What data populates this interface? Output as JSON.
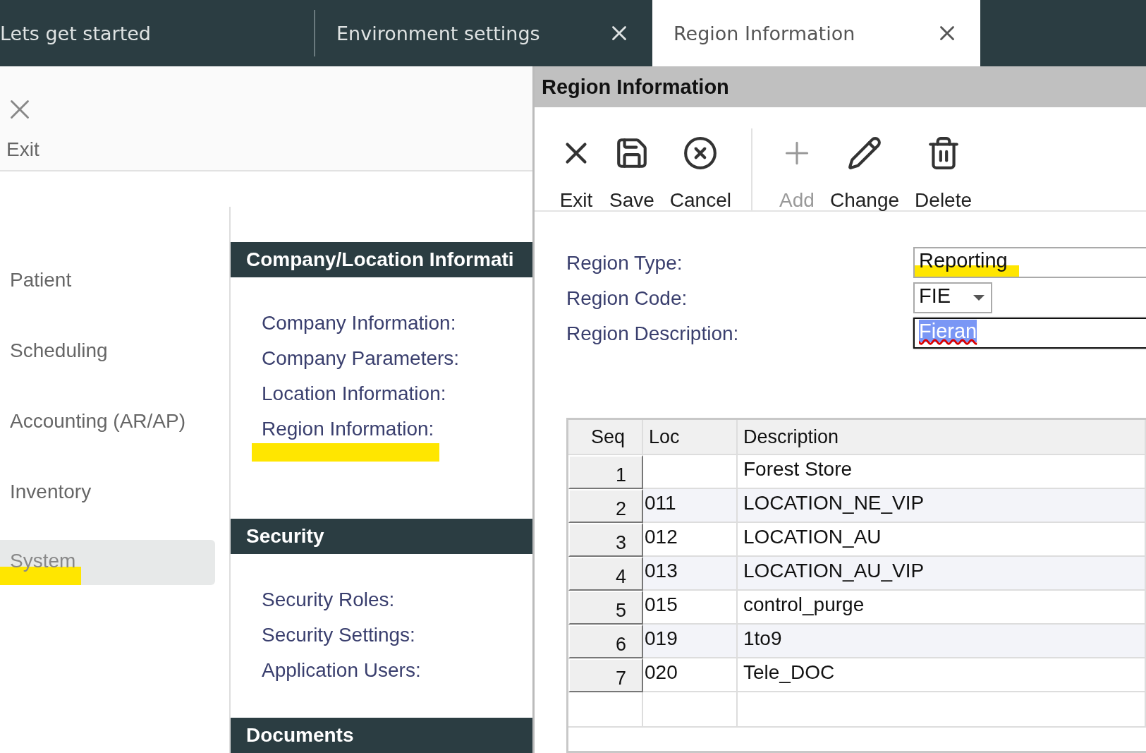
{
  "tabs": [
    {
      "label": "Lets get started",
      "selected": false,
      "closable": false
    },
    {
      "label": "Environment settings",
      "selected": false,
      "closable": true
    },
    {
      "label": "Region Information",
      "selected": true,
      "closable": true
    }
  ],
  "left_toolbar": {
    "exit_label": "Exit"
  },
  "sidebar": {
    "items": [
      {
        "label": "Patient",
        "selected": false,
        "highlighted": false
      },
      {
        "label": "Scheduling",
        "selected": false,
        "highlighted": false
      },
      {
        "label": "Accounting (AR/AP)",
        "selected": false,
        "highlighted": false
      },
      {
        "label": "Inventory",
        "selected": false,
        "highlighted": false
      },
      {
        "label": "System",
        "selected": true,
        "highlighted": true
      }
    ]
  },
  "sections": [
    {
      "title": "Company/Location Informati",
      "links": [
        {
          "label": "Company Information:",
          "highlighted": false
        },
        {
          "label": "Company Parameters:",
          "highlighted": false
        },
        {
          "label": "Location Information:",
          "highlighted": false
        },
        {
          "label": "Region Information:",
          "highlighted": true
        }
      ]
    },
    {
      "title": "Security",
      "links": [
        {
          "label": "Security Roles:",
          "highlighted": false
        },
        {
          "label": "Security Settings:",
          "highlighted": false
        },
        {
          "label": "Application Users:",
          "highlighted": false
        }
      ]
    },
    {
      "title": "Documents"
    }
  ],
  "dialog": {
    "title": "Region Information",
    "toolbar": [
      {
        "kind": "exit",
        "label": "Exit",
        "disabled": false
      },
      {
        "kind": "save",
        "label": "Save",
        "disabled": false
      },
      {
        "kind": "cancel",
        "label": "Cancel",
        "disabled": false
      },
      {
        "kind": "add",
        "label": "Add",
        "disabled": true
      },
      {
        "kind": "change",
        "label": "Change",
        "disabled": false
      },
      {
        "kind": "delete",
        "label": "Delete",
        "disabled": false
      }
    ],
    "fields": [
      {
        "label": "Region Type:",
        "kind": "text",
        "value": "Reporting",
        "highlighted": true,
        "focused": false
      },
      {
        "label": "Region Code:",
        "kind": "select",
        "value": "FIE",
        "highlighted": false,
        "focused": false
      },
      {
        "label": "Region Description:",
        "kind": "text",
        "value": "Fieran",
        "highlighted": false,
        "focused": true
      }
    ],
    "table": {
      "columns": [
        "Seq",
        "Loc",
        "Description"
      ],
      "rows": [
        {
          "seq": "1",
          "description": "Forest Store"
        },
        {
          "seq": "2",
          "loc": "011",
          "description": "LOCATION_NE_VIP"
        },
        {
          "seq": "3",
          "loc": "012",
          "description": "LOCATION_AU"
        },
        {
          "seq": "4",
          "loc": "013",
          "description": "LOCATION_AU_VIP"
        },
        {
          "seq": "5",
          "loc": "015",
          "description": "control_purge"
        },
        {
          "seq": "6",
          "loc": "019",
          "description": "1to9"
        },
        {
          "seq": "7",
          "loc": "020",
          "description": "Tele_DOC"
        }
      ]
    }
  }
}
